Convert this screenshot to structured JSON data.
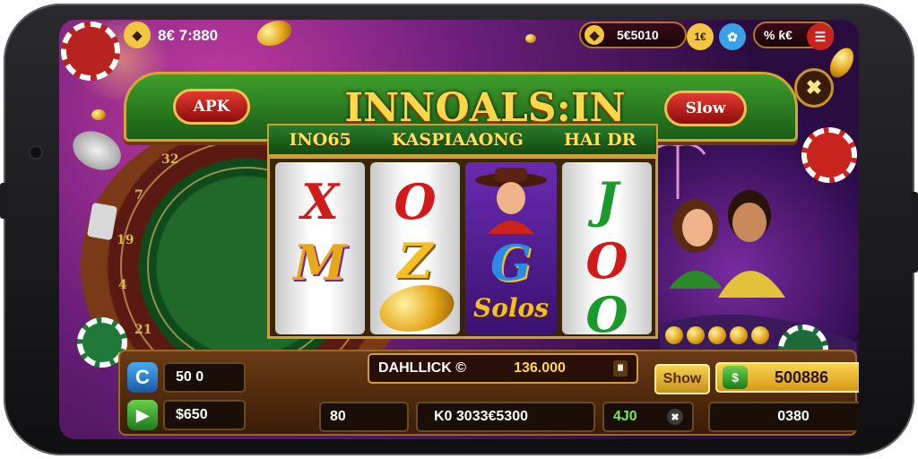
{
  "top_bar": {
    "balance": "8€ 7:880",
    "coins": "5€5010",
    "level": "1€",
    "timer": "% ƙ€"
  },
  "banner": {
    "apk_label": "APK",
    "title": "INNOALS:IN",
    "slow_label": "Slow",
    "close_symbol": "✖"
  },
  "subbar": {
    "left": "INO65",
    "middle": "KASPIAAONG",
    "right": "HAI DR"
  },
  "reels": [
    {
      "top": "X",
      "middle": "M",
      "bottom": ""
    },
    {
      "top": "O",
      "middle": "Z",
      "bottom": ""
    },
    {
      "top": "",
      "middle": "G",
      "bottom": "Solos"
    },
    {
      "top": "J",
      "middle": "O",
      "bottom": "O"
    }
  ],
  "bottom_panel": {
    "bet_value": "50 0",
    "win_value": "$650",
    "info_label": "DAHLLICK ©",
    "info_value": "136.000",
    "show_label": "Show",
    "total_value": "500886",
    "box_a": "80",
    "box_b": "K0 3033€5300",
    "box_c": "4J0",
    "box_d": "0380"
  },
  "colors": {
    "gold": "#ffd84a",
    "accent_red": "#c8231d",
    "table_green": "#1f6a2a",
    "bg_purple": "#6b1f7a"
  },
  "icons": [
    "balance-coin-icon",
    "coin-stack-icon",
    "settings-icon",
    "menu-icon",
    "close-icon",
    "refresh-icon",
    "play-icon",
    "dollar-icon",
    "pause-icon"
  ]
}
